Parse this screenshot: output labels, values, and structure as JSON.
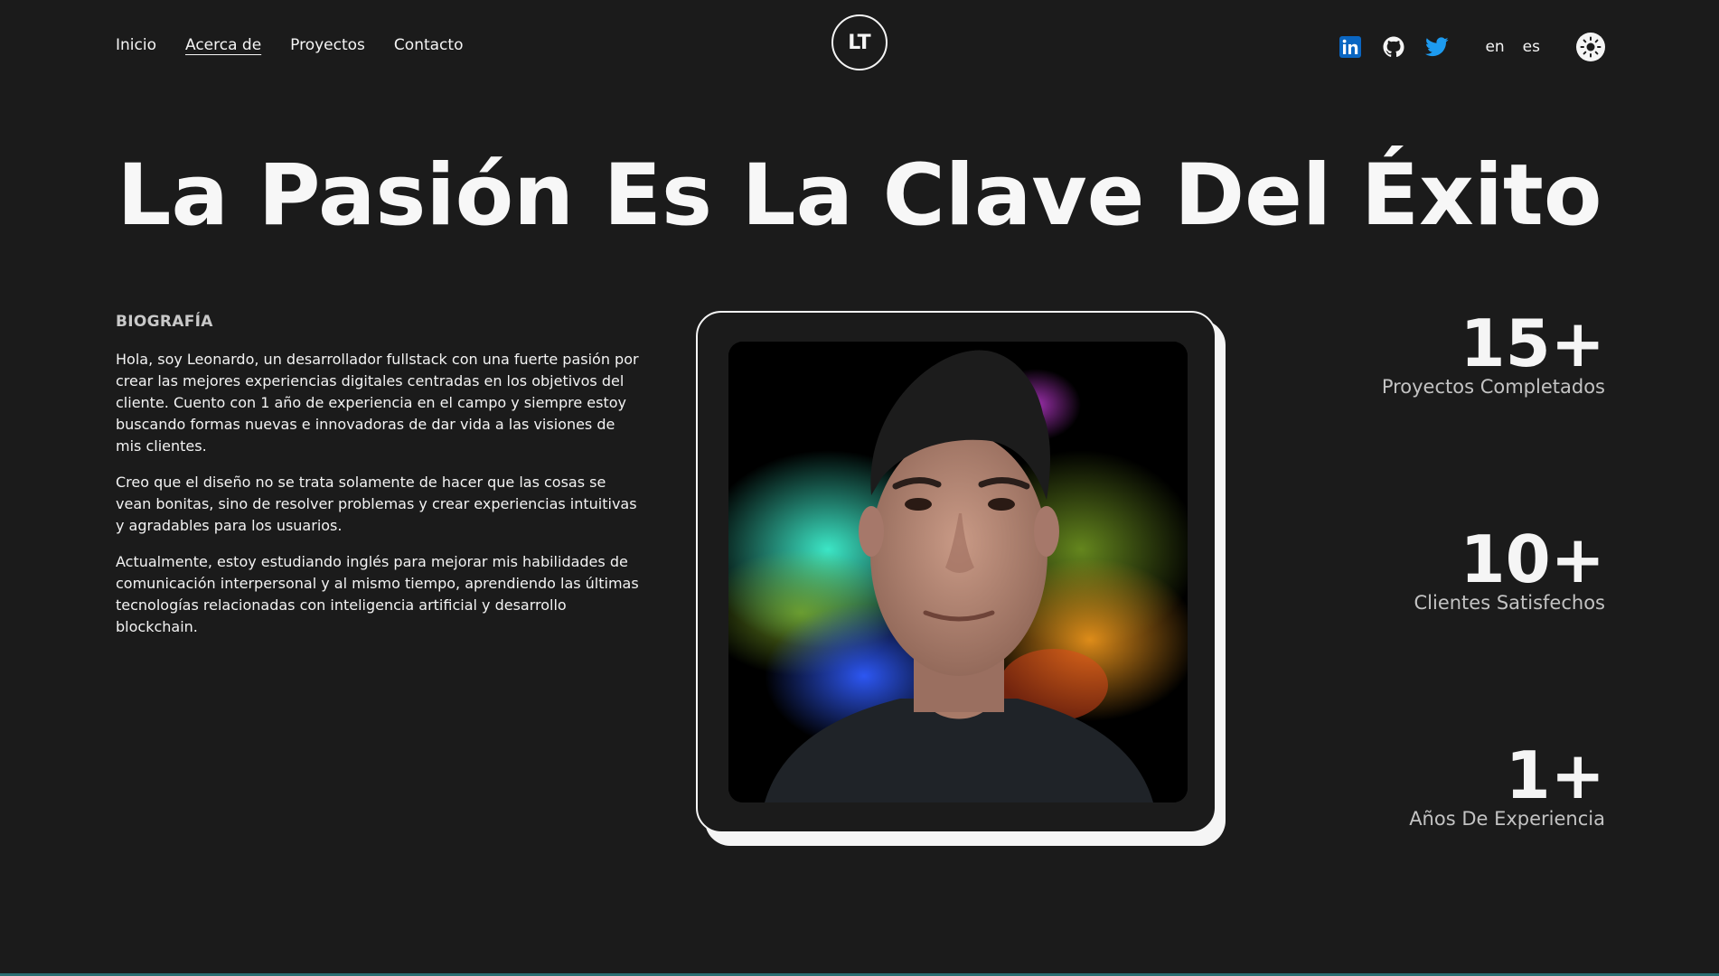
{
  "nav": {
    "links": [
      {
        "label": "Inicio"
      },
      {
        "label": "Acerca de"
      },
      {
        "label": "Proyectos"
      },
      {
        "label": "Contacto"
      }
    ],
    "logo_text": "LT",
    "languages": [
      "en",
      "es"
    ],
    "social": [
      "linkedin-icon",
      "github-icon",
      "twitter-icon"
    ]
  },
  "headline": "La Pasión Es La Clave Del Éxito",
  "bio": {
    "title": "BIOGRAFÍA",
    "paragraphs": [
      "Hola, soy Leonardo, un desarrollador fullstack con una fuerte pasión por crear las mejores experiencias digitales centradas en los objetivos del cliente. Cuento con 1 año de experiencia en el campo y siempre estoy buscando formas nuevas e innovadoras de dar vida a las visiones de mis clientes.",
      "Creo que el diseño no se trata solamente de hacer que las cosas se vean bonitas, sino de resolver problemas y crear experiencias intuitivas y agradables para los usuarios.",
      "Actualmente, estoy estudiando inglés para mejorar mis habilidades de comunicación interpersonal y al mismo tiempo, aprendiendo las últimas tecnologías relacionadas con inteligencia artificial y desarrollo blockchain."
    ]
  },
  "stats": [
    {
      "value": "15+",
      "label": "Proyectos Completados"
    },
    {
      "value": "10+",
      "label": "Clientes Satisfechos"
    },
    {
      "value": "1+",
      "label": "Años De Experiencia"
    }
  ],
  "colors": {
    "background": "#1b1b1b",
    "foreground": "#f5f5f5",
    "linkedin": "#0a66c2",
    "twitter": "#1d9bf0"
  }
}
